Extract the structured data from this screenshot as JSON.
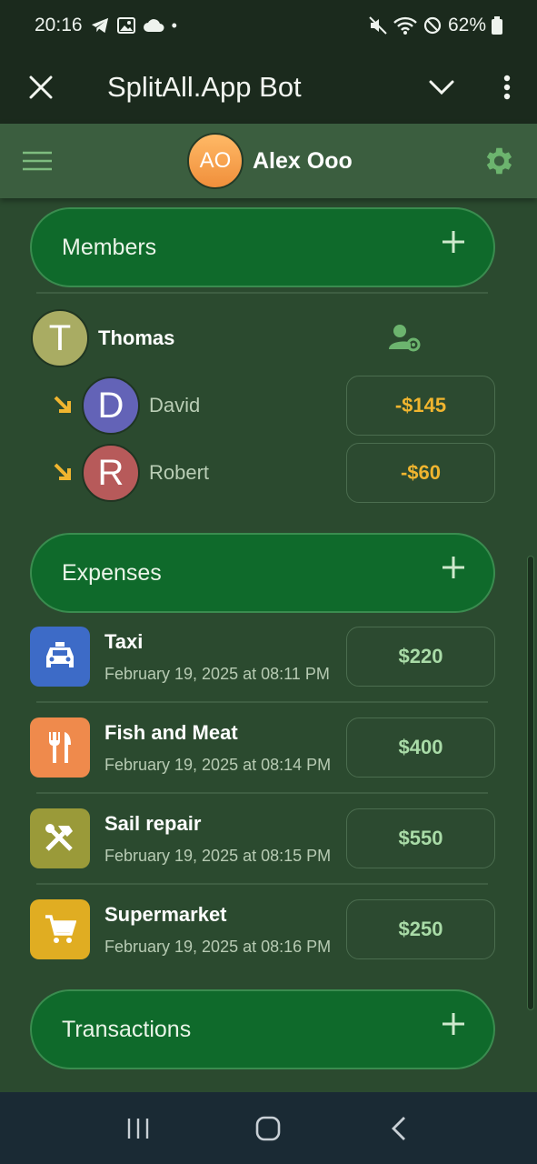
{
  "status_bar": {
    "time": "20:16",
    "battery": "62%"
  },
  "app_bar": {
    "title": "SplitAll.App Bot"
  },
  "header": {
    "user_initials": "AO",
    "user_name": "Alex Ooo"
  },
  "members": {
    "label": "Members",
    "root": {
      "initial": "T",
      "name": "Thomas",
      "color": "#a9ac63"
    },
    "debts": [
      {
        "initial": "D",
        "name": "David",
        "amount": "-$145",
        "color": "#6363b7"
      },
      {
        "initial": "R",
        "name": "Robert",
        "amount": "-$60",
        "color": "#b75a5a"
      }
    ]
  },
  "expenses": {
    "label": "Expenses",
    "items": [
      {
        "title": "Taxi",
        "date": "February 19, 2025 at 08:11 PM",
        "amount": "$220",
        "icon": "taxi-icon",
        "color": "#3d6bc7"
      },
      {
        "title": "Fish and Meat",
        "date": "February 19, 2025 at 08:14 PM",
        "amount": "$400",
        "icon": "restaurant-icon",
        "color": "#ef8a4c"
      },
      {
        "title": "Sail repair",
        "date": "February 19, 2025 at 08:15 PM",
        "amount": "$550",
        "icon": "tools-icon",
        "color": "#9a9a39"
      },
      {
        "title": "Supermarket",
        "date": "February 19, 2025 at 08:16 PM",
        "amount": "$250",
        "icon": "cart-icon",
        "color": "#e0ad22"
      }
    ]
  },
  "transactions": {
    "label": "Transactions"
  }
}
